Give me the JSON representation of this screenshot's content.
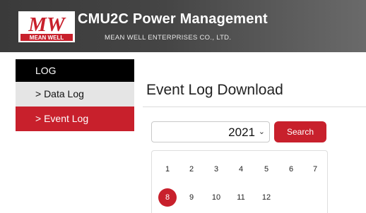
{
  "header": {
    "title": "CMU2C Power Management",
    "company": "MEAN WELL ENTERPRISES CO., LTD.",
    "logo": {
      "mark": "MW",
      "text": "MEAN WELL"
    }
  },
  "sidebar": {
    "heading": "LOG",
    "items": [
      {
        "label": "> Data Log",
        "active": false
      },
      {
        "label": "> Event Log",
        "active": true
      }
    ]
  },
  "main": {
    "title": "Event Log Download",
    "year": "2021",
    "search_label": "Search",
    "months": [
      "1",
      "2",
      "3",
      "4",
      "5",
      "6",
      "7",
      "8",
      "9",
      "10",
      "11",
      "12"
    ],
    "selected_month": "8"
  },
  "colors": {
    "accent": "#c8202c",
    "sidebar_heading_bg": "#000000",
    "sidebar_item_bg": "#e5e5e5"
  }
}
